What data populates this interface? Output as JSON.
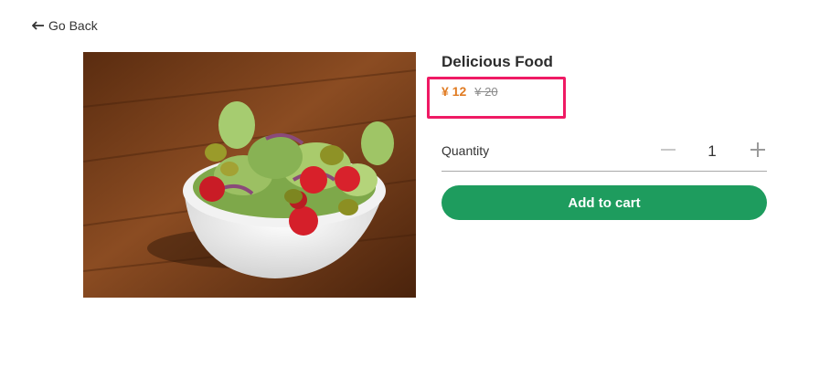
{
  "nav": {
    "back_label": "Go Back",
    "back_icon": "arrow-left-icon"
  },
  "product": {
    "image_alt": "salad-bowl-photo",
    "title": "Delicious Food",
    "price_current": "¥ 12",
    "price_original": "¥ 20"
  },
  "quantity": {
    "label": "Quantity",
    "value": "1",
    "minus_icon": "minus-icon",
    "plus_icon": "plus-icon"
  },
  "actions": {
    "add_to_cart_label": "Add to cart"
  },
  "colors": {
    "accent_green": "#1e9c5e",
    "price_orange": "#e07b22",
    "highlight_pink": "#ef1a64"
  }
}
